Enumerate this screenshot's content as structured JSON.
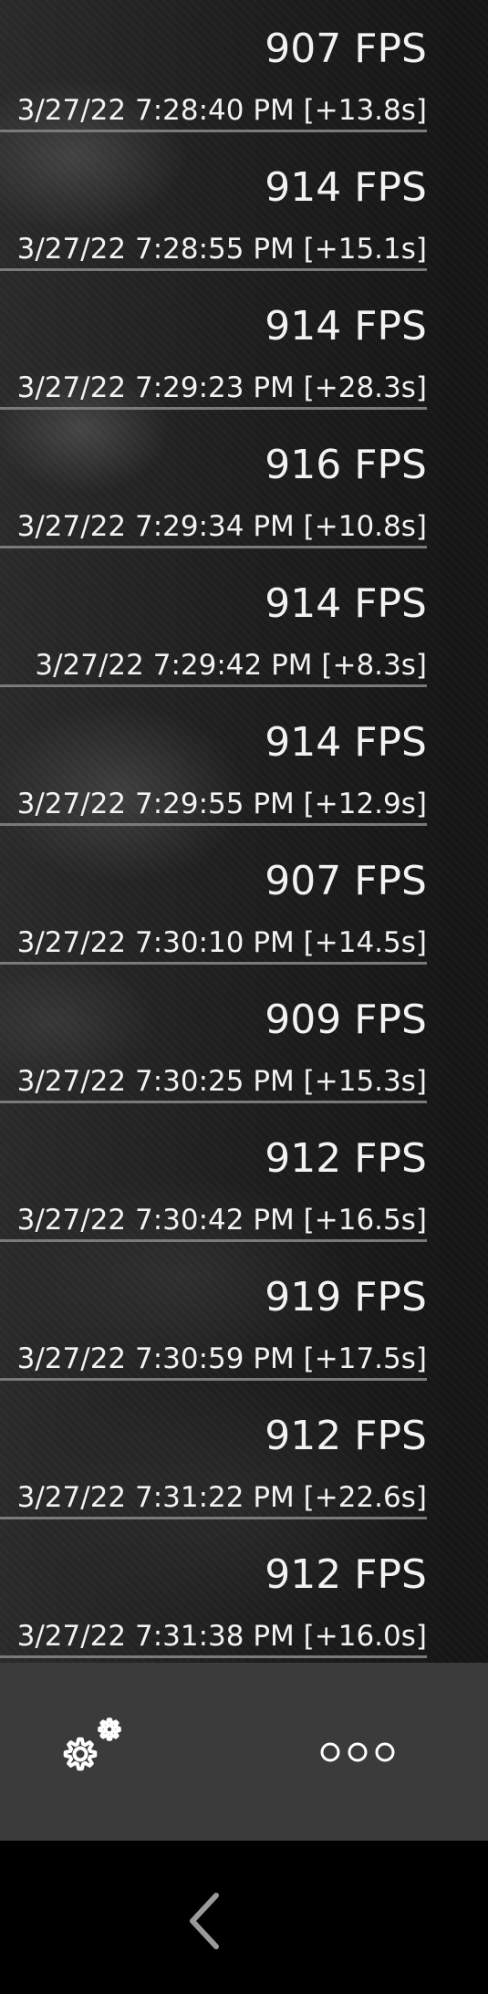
{
  "records": [
    {
      "fps": "907 FPS",
      "timestamp": "3/27/22 7:28:40 PM [+13.8s]"
    },
    {
      "fps": "914 FPS",
      "timestamp": "3/27/22 7:28:55 PM [+15.1s]"
    },
    {
      "fps": "914 FPS",
      "timestamp": "3/27/22 7:29:23 PM [+28.3s]"
    },
    {
      "fps": "916 FPS",
      "timestamp": "3/27/22 7:29:34 PM [+10.8s]"
    },
    {
      "fps": "914 FPS",
      "timestamp": "3/27/22 7:29:42 PM [+8.3s]"
    },
    {
      "fps": "914 FPS",
      "timestamp": "3/27/22 7:29:55 PM [+12.9s]"
    },
    {
      "fps": "907 FPS",
      "timestamp": "3/27/22 7:30:10 PM [+14.5s]"
    },
    {
      "fps": "909 FPS",
      "timestamp": "3/27/22 7:30:25 PM [+15.3s]"
    },
    {
      "fps": "912 FPS",
      "timestamp": "3/27/22 7:30:42 PM [+16.5s]"
    },
    {
      "fps": "919 FPS",
      "timestamp": "3/27/22 7:30:59 PM [+17.5s]"
    },
    {
      "fps": "912 FPS",
      "timestamp": "3/27/22 7:31:22 PM [+22.6s]"
    },
    {
      "fps": "912 FPS",
      "timestamp": "3/27/22 7:31:38 PM [+16.0s]"
    }
  ],
  "toolbar": {
    "settings_icon": "gears-icon",
    "more_icon": "more-options-icon"
  },
  "navbar": {
    "back_icon": "chevron-left-icon"
  },
  "colors": {
    "text": "#f2f2f2",
    "divider": "#7a7a7a",
    "toolbar_bg": "#3b3b3b",
    "navbar_bg": "#000000"
  }
}
